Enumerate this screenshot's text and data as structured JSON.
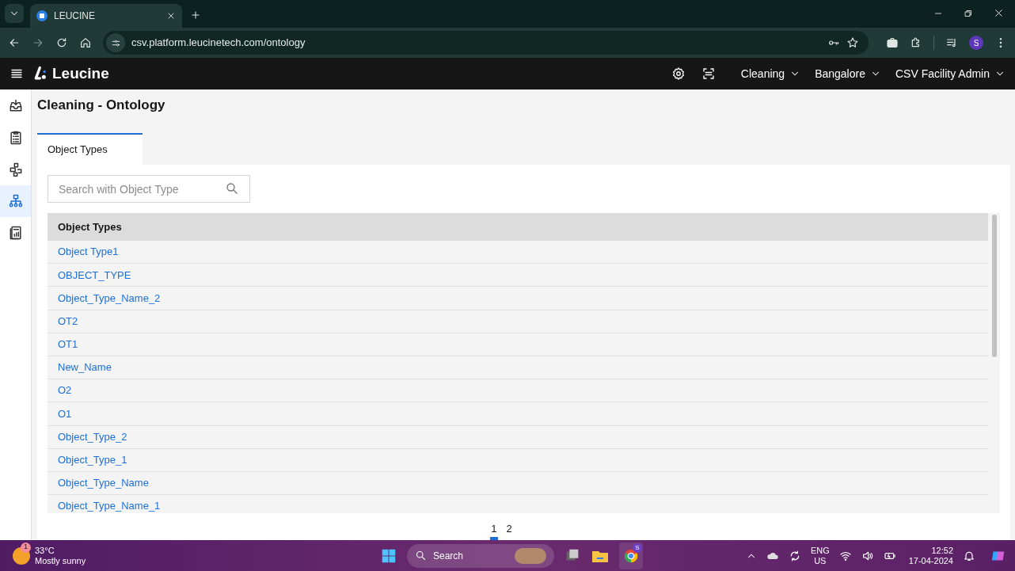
{
  "browser": {
    "tabs": [
      {
        "title": "LEUCINE",
        "selected": true
      }
    ],
    "url": "csv.platform.leucinetech.com/ontology",
    "profile_initial": "S"
  },
  "app_header": {
    "brand": "Leucine",
    "menus": [
      {
        "label": "Cleaning"
      },
      {
        "label": "Bangalore"
      },
      {
        "label": "CSV Facility Admin"
      }
    ]
  },
  "sidebar": {
    "items": [
      {
        "kind": "inbox",
        "selected": false
      },
      {
        "kind": "checklist",
        "selected": false
      },
      {
        "kind": "flow",
        "selected": false
      },
      {
        "kind": "hierarchy",
        "selected": true
      },
      {
        "kind": "report",
        "selected": false
      }
    ]
  },
  "page": {
    "title": "Cleaning - Ontology",
    "tabs": [
      {
        "label": "Object Types",
        "selected": true
      }
    ],
    "search": {
      "placeholder": "Search with Object Type"
    },
    "table": {
      "columns": [
        "Object Types"
      ],
      "rows": [
        [
          "Object Type1"
        ],
        [
          "OBJECT_TYPE"
        ],
        [
          "Object_Type_Name_2"
        ],
        [
          "OT2"
        ],
        [
          "OT1"
        ],
        [
          "New_Name"
        ],
        [
          "O2"
        ],
        [
          "O1"
        ],
        [
          "Object_Type_2"
        ],
        [
          "Object_Type_1"
        ],
        [
          "Object_Type_Name"
        ],
        [
          "Object_Type_Name_1"
        ]
      ]
    },
    "pagination": [
      {
        "label": "1",
        "selected": true
      },
      {
        "label": "2",
        "selected": false
      }
    ]
  },
  "taskbar": {
    "weather": {
      "badge": "1",
      "temperature": "33°C",
      "condition": "Mostly sunny"
    },
    "search": "Search",
    "chrome_badge": "S",
    "language": "ENG",
    "region": "US",
    "time": "12:52",
    "date": "17-04-2024"
  }
}
